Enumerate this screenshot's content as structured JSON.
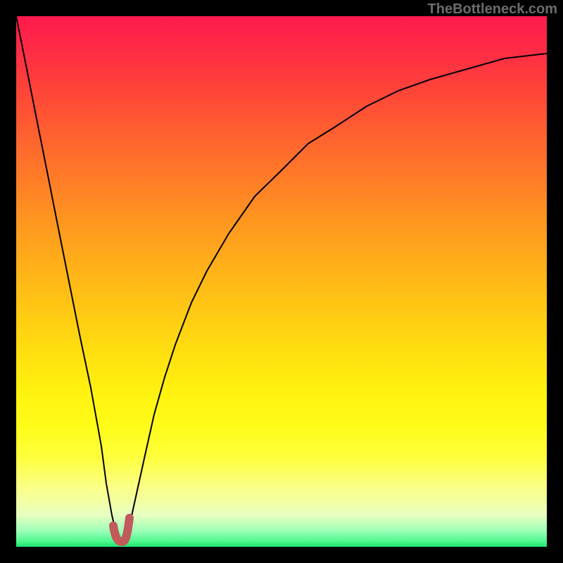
{
  "watermark": "TheBottleneck.com",
  "chart_data": {
    "type": "line",
    "title": "",
    "xlabel": "",
    "ylabel": "",
    "xlim": [
      0,
      100
    ],
    "ylim": [
      0,
      100
    ],
    "series": [
      {
        "name": "bottleneck-curve",
        "x": [
          0,
          2,
          4,
          6,
          8,
          10,
          12,
          14,
          16,
          17,
          18,
          19,
          20,
          21,
          22,
          24,
          26,
          28,
          30,
          33,
          36,
          40,
          45,
          50,
          55,
          60,
          66,
          72,
          78,
          85,
          92,
          100
        ],
        "values": [
          100,
          90,
          80,
          70,
          60,
          50,
          40,
          30,
          19,
          12,
          6,
          2,
          1,
          2,
          7,
          16,
          25,
          32,
          38,
          46,
          52,
          59,
          66,
          71,
          76,
          79,
          83,
          86,
          88,
          90,
          92,
          93
        ]
      },
      {
        "name": "optimal-marker",
        "x": [
          18.3,
          18.6,
          19.0,
          19.4,
          19.8,
          20.2,
          20.6,
          21.0,
          21.3
        ],
        "values": [
          4.0,
          2.2,
          1.2,
          0.8,
          0.9,
          1.4,
          2.4,
          4.0,
          5.5
        ]
      }
    ],
    "gradient_stops": [
      {
        "pos": 0,
        "color": "#ff1a4d"
      },
      {
        "pos": 50,
        "color": "#ffc414"
      },
      {
        "pos": 80,
        "color": "#feff3c"
      },
      {
        "pos": 100,
        "color": "#20e26e"
      }
    ]
  }
}
